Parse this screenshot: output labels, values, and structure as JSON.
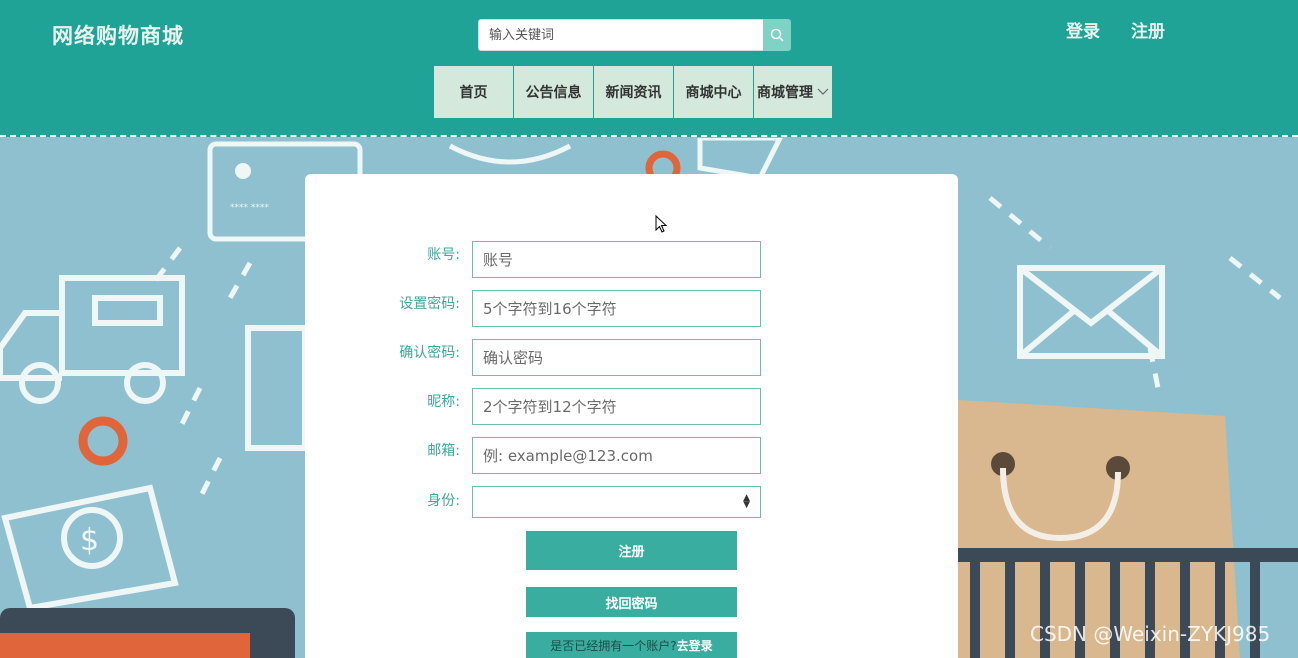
{
  "header": {
    "logo": "网络购物商城",
    "search": {
      "placeholder": "输入关键词",
      "icon": "search-icon"
    },
    "login": "登录",
    "register": "注册"
  },
  "nav": [
    {
      "label": "首页"
    },
    {
      "label": "公告信息"
    },
    {
      "label": "新闻资讯"
    },
    {
      "label": "商城中心"
    },
    {
      "label": "商城管理",
      "icon": "chevron-down-icon"
    }
  ],
  "form": {
    "fields": [
      {
        "label": "账号:",
        "placeholder": "账号"
      },
      {
        "label": "设置密码:",
        "placeholder": "5个字符到16个字符"
      },
      {
        "label": "确认密码:",
        "placeholder": "确认密码"
      },
      {
        "label": "昵称:",
        "placeholder": "2个字符到12个字符"
      },
      {
        "label": "邮箱:",
        "placeholder": "例: example@123.com"
      }
    ],
    "identity_label": "身份:",
    "identity_value": "",
    "register_button": "注册",
    "forgot_button": "找回密码",
    "have_account_text": "是否已经拥有一个账户?",
    "go_login_link": "去登录"
  },
  "watermark": "CSDN @Weixin-ZYKJ985",
  "colors": {
    "header_bg": "#1fa397",
    "nav_item_bg": "#d4e9dc",
    "accent": "#3aada1",
    "page_bg": "#8fc0cf"
  }
}
